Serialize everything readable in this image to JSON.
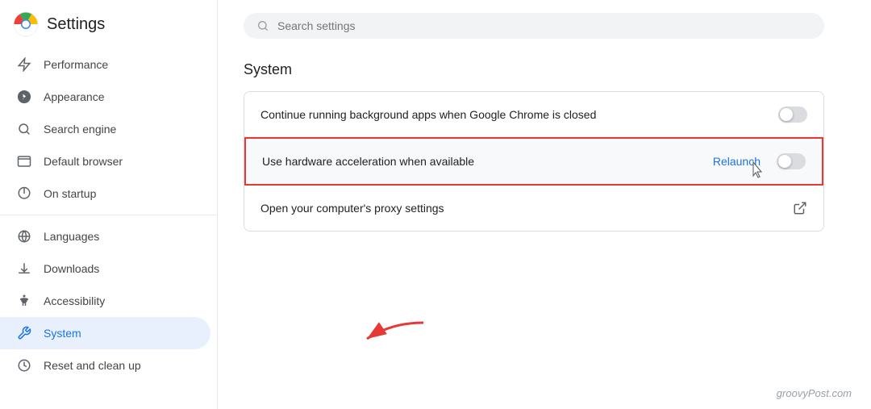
{
  "sidebar": {
    "title": "Settings",
    "items": [
      {
        "id": "performance",
        "label": "Performance",
        "icon": "⚡"
      },
      {
        "id": "appearance",
        "label": "Appearance",
        "icon": "🎨"
      },
      {
        "id": "search-engine",
        "label": "Search engine",
        "icon": "🔍"
      },
      {
        "id": "default-browser",
        "label": "Default browser",
        "icon": "⬛"
      },
      {
        "id": "on-startup",
        "label": "On startup",
        "icon": "⏻"
      },
      {
        "id": "divider",
        "label": "",
        "icon": ""
      },
      {
        "id": "languages",
        "label": "Languages",
        "icon": "🌐"
      },
      {
        "id": "downloads",
        "label": "Downloads",
        "icon": "⬇"
      },
      {
        "id": "accessibility",
        "label": "Accessibility",
        "icon": "♿"
      },
      {
        "id": "system",
        "label": "System",
        "icon": "🔧",
        "active": true
      },
      {
        "id": "reset",
        "label": "Reset and clean up",
        "icon": "🕐"
      }
    ]
  },
  "search": {
    "placeholder": "Search settings"
  },
  "main": {
    "section_title": "System",
    "rows": [
      {
        "id": "background-apps",
        "text": "Continue running background apps when Google Chrome is closed",
        "toggle": false,
        "has_relaunch": false,
        "has_external": false
      },
      {
        "id": "hardware-acceleration",
        "text": "Use hardware acceleration when available",
        "toggle": false,
        "has_relaunch": true,
        "relaunch_label": "Relaunch",
        "has_external": false,
        "highlighted": true
      },
      {
        "id": "proxy-settings",
        "text": "Open your computer's proxy settings",
        "toggle": false,
        "has_relaunch": false,
        "has_external": true
      }
    ]
  },
  "watermark": "groovyPost.com"
}
